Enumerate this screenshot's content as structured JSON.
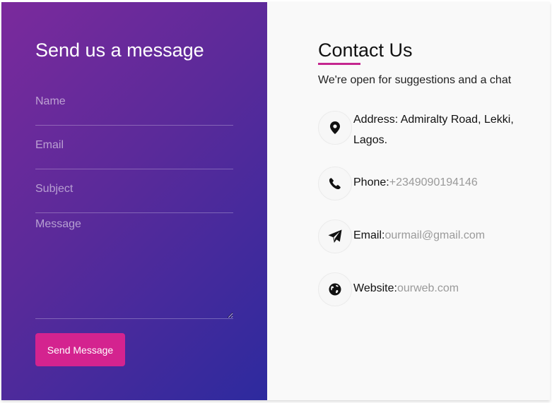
{
  "form": {
    "title": "Send us a message",
    "name_placeholder": "Name",
    "email_placeholder": "Email",
    "subject_placeholder": "Subject",
    "message_placeholder": "Message",
    "submit_label": "Send Message"
  },
  "contact": {
    "title": "Contact Us",
    "subtitle": "We're open for suggestions and a chat",
    "address": {
      "label": "Address:",
      "value": " Admiralty Road, Lekki, Lagos.",
      "icon": "map-pin-icon"
    },
    "phone": {
      "label": "Phone:",
      "value": "+2349090194146",
      "icon": "phone-icon"
    },
    "email": {
      "label": "Email:",
      "value": "ourmail@gmail.com",
      "icon": "paper-plane-icon"
    },
    "website": {
      "label": "Website:",
      "value": "ourweb.com",
      "icon": "globe-icon"
    }
  },
  "colors": {
    "gradient_start": "#7b2a9c",
    "gradient_end": "#2d2a9e",
    "accent": "#d4238f",
    "info_panel_bg": "#f9f9f9"
  }
}
